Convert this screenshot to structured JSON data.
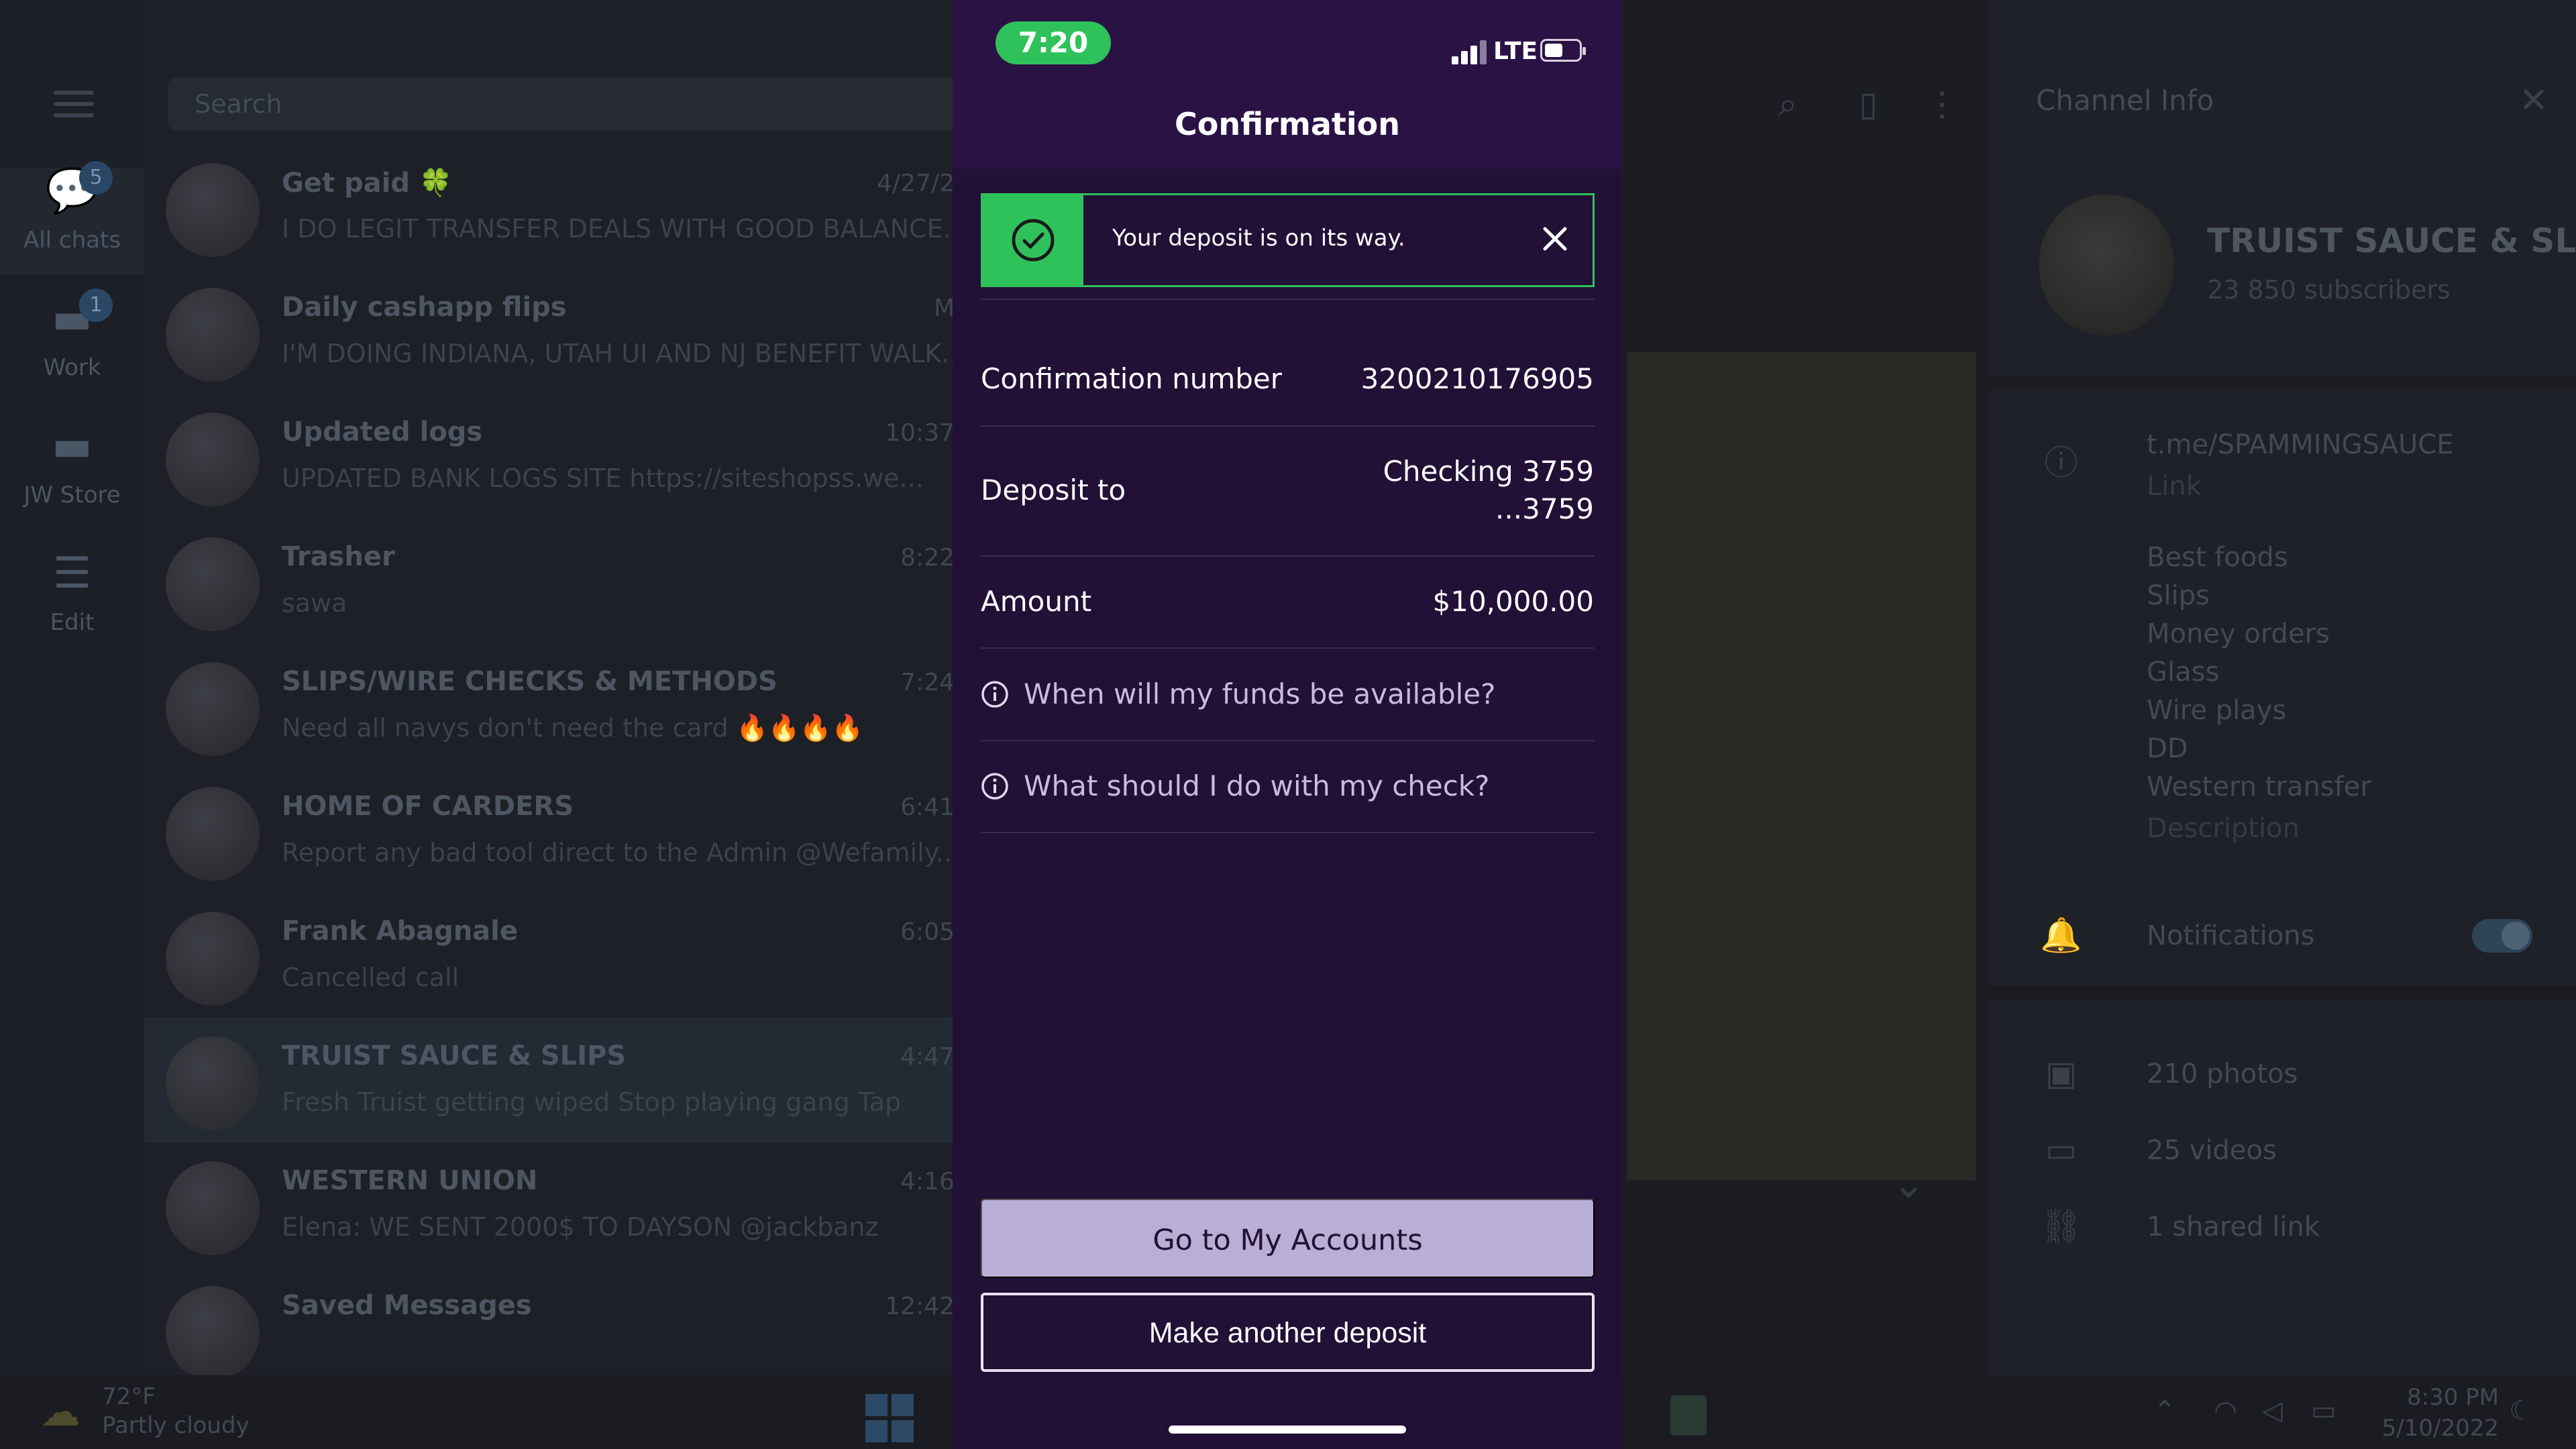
{
  "background": {
    "rail": [
      {
        "label": "All chats",
        "badge": "5",
        "icon": "chat-bubbles-icon"
      },
      {
        "label": "Work",
        "badge": "1",
        "icon": "folder-icon"
      },
      {
        "label": "JW Store",
        "badge": "",
        "icon": "folder-icon"
      },
      {
        "label": "Edit",
        "badge": "",
        "icon": "sliders-icon"
      }
    ],
    "search_placeholder": "Search",
    "chats": [
      {
        "title": "Get paid 🍀",
        "time": "4/27/2",
        "preview": "I DO LEGIT TRANSFER DEALS WITH GOOD BALANCE..."
      },
      {
        "title": "Daily cashapp flips",
        "time": "M",
        "preview": "I'M DOING INDIANA, UTAH UI AND NJ BENEFIT WALK..."
      },
      {
        "title": "Updated logs",
        "time": "10:37",
        "preview": "UPDATED BANK LOGS SITE https://siteshopss.we..."
      },
      {
        "title": "Trasher",
        "time": "8:22",
        "preview": "sawa"
      },
      {
        "title": "SLIPS/WIRE CHECKS & METHODS",
        "time": "7:24",
        "preview": "Need all navys don't need the card 🔥🔥🔥🔥"
      },
      {
        "title": "HOME OF CARDERS",
        "time": "6:41",
        "preview": "Report any bad tool direct to the Admin @Wefamily..."
      },
      {
        "title": "Frank Abagnale",
        "time": "6:05",
        "preview": "Cancelled call"
      },
      {
        "title": "TRUIST SAUCE & SLIPS",
        "time": "4:47",
        "preview": "Fresh Truist getting wiped Stop playing gang Tap"
      },
      {
        "title": "WESTERN UNION",
        "time": "4:16",
        "preview": "Elena: WE SENT 2000$ TO DAYSON @jackbanz"
      },
      {
        "title": "Saved Messages",
        "time": "12:42",
        "preview": ""
      }
    ],
    "info_panel": {
      "title": "Channel Info",
      "name": "TRUIST SAUCE & SL...",
      "subscribers": "23 850 subscribers",
      "link": "t.me/SPAMMINGSAUCE",
      "link_label": "Link",
      "description_lines": [
        "Best foods",
        "Slips",
        "Money orders",
        "Glass",
        "Wire plays",
        "DD",
        "Western transfer"
      ],
      "description_label": "Description",
      "notifications": "Notifications",
      "photos": "210 photos",
      "videos": "25 videos",
      "shared_links": "1 shared link"
    },
    "taskbar": {
      "temperature": "72°F",
      "condition": "Partly cloudy",
      "clock_time": "8:30 PM",
      "clock_date": "5/10/2022"
    }
  },
  "phone": {
    "status": {
      "time": "7:20",
      "network": "LTE"
    },
    "title": "Confirmation",
    "toast": {
      "message": "Your deposit is on its way.",
      "color": "#2fc25b"
    },
    "details": [
      {
        "label": "Confirmation number",
        "value": "3200210176905",
        "value2": ""
      },
      {
        "label": "Deposit to",
        "value": "Checking 3759",
        "value2": "...3759"
      },
      {
        "label": "Amount",
        "value": "$10,000.00",
        "value2": ""
      }
    ],
    "help": [
      {
        "text": "When will my funds be available?"
      },
      {
        "text": "What should I do with my check?"
      }
    ],
    "buttons": {
      "primary": "Go to My Accounts",
      "secondary": "Make another deposit"
    },
    "colors": {
      "background": "#221036",
      "header": "#2a1245",
      "primary_button": "#b8aed6"
    }
  }
}
